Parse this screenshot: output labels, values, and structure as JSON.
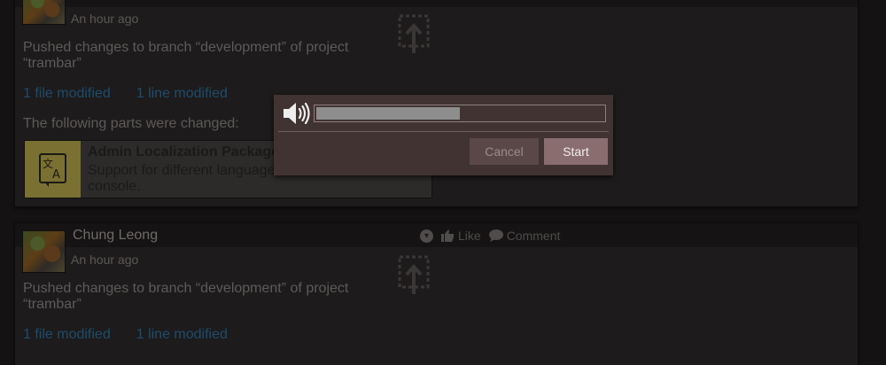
{
  "stories": [
    {
      "author": "",
      "time": "An hour ago",
      "text": "Pushed changes to branch “development” of project “trambar”",
      "files_link": "1 file modified",
      "lines_link": "1 line modified",
      "parts_heading": "The following parts were changed:",
      "component": {
        "title": "Admin Localization Package",
        "description": "Support for different languages in the Administrative console."
      }
    },
    {
      "author": "Chung Leong",
      "time": "An hour ago",
      "like_label": "Like",
      "comment_label": "Comment",
      "text": "Pushed changes to branch “development” of project “trambar”",
      "files_link": "1 file modified",
      "lines_link": "1 line modified"
    }
  ],
  "dialog": {
    "volume_level": 0.5,
    "cancel_label": "Cancel",
    "start_label": "Start",
    "icon": "speaker-icon"
  },
  "colors": {
    "dialog_background": "#413332",
    "start_button": "#8a6d6e",
    "cancel_button": "#5a4847",
    "volume_fill": "#8d8d8d",
    "link_color": "#1e4c6e"
  }
}
